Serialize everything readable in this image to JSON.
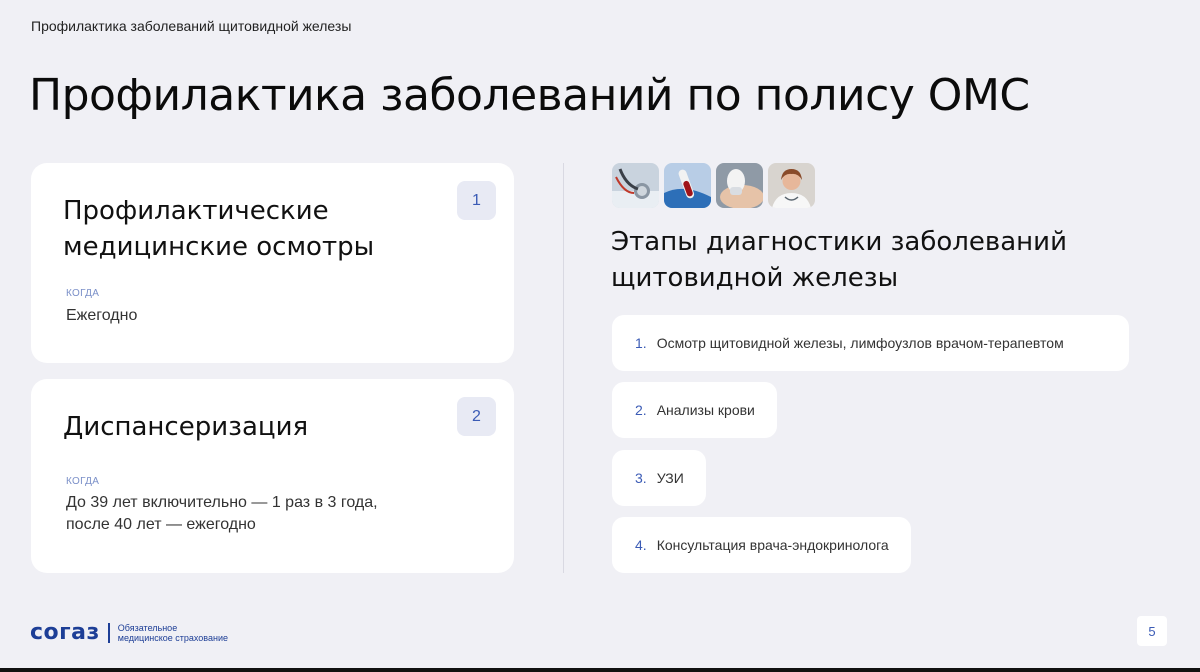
{
  "header": {
    "section_title": "Профилактика заболеваний щитовидной железы",
    "page_title": "Профилактика заболеваний по полису ОМС"
  },
  "cards": [
    {
      "number": "1",
      "title_line1": "Профилактические",
      "title_line2": "медицинские осмотры",
      "when_label": "когда",
      "when_value": "Ежегодно"
    },
    {
      "number": "2",
      "title_line1": "Диспансеризация",
      "when_label": "когда",
      "when_value_line1": "До 39 лет включительно — 1 раз в 3 года,",
      "when_value_line2": "после 40 лет — ежегодно"
    }
  ],
  "photos": [
    "stethoscope-photo",
    "blood-test-photo",
    "ultrasound-photo",
    "doctor-photo"
  ],
  "stages": {
    "title_line1": "Этапы диагностики заболеваний",
    "title_line2": "щитовидной железы",
    "items": [
      {
        "num": "1.",
        "label": "Осмотр щитовидной железы, лимфоузлов врачом-терапевтом"
      },
      {
        "num": "2.",
        "label": "Анализы крови"
      },
      {
        "num": "3.",
        "label": "УЗИ"
      },
      {
        "num": "4.",
        "label": "Консультация врача-эндокринолога"
      }
    ]
  },
  "footer": {
    "logo_text": "согаз",
    "logo_sub_line1": "Обязательное",
    "logo_sub_line2": "медицинское страхование",
    "page_number": "5"
  },
  "colors": {
    "background": "#f0f0f5",
    "accent": "#3b5bb5",
    "brand": "#1d3e96"
  }
}
